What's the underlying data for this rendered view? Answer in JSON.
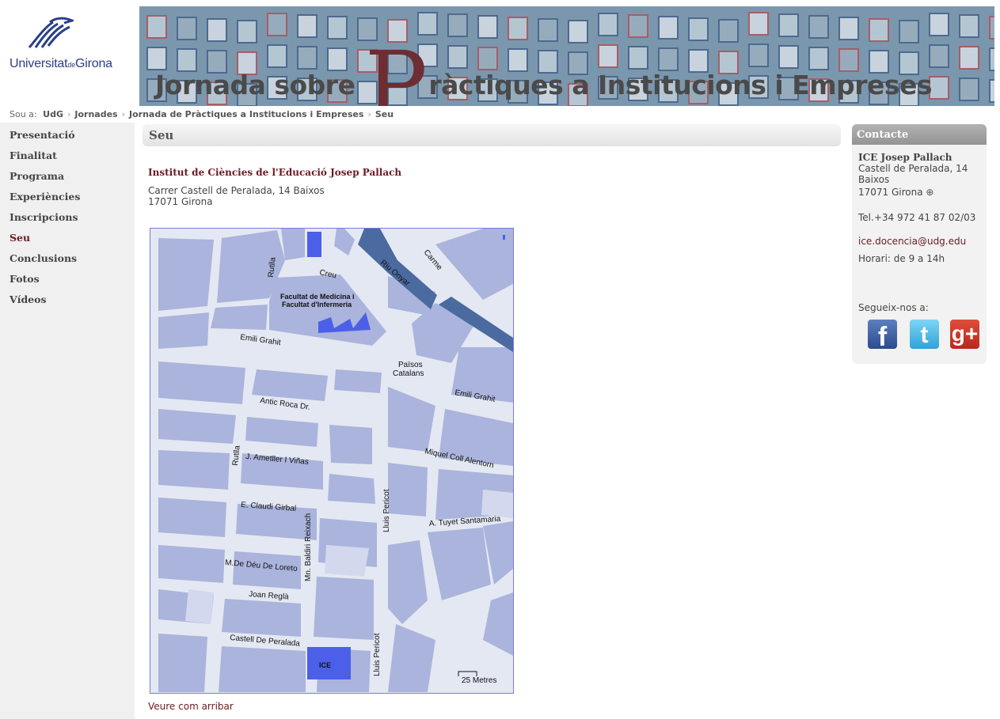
{
  "logo": {
    "name_a": "Universitat",
    "name_de": "de",
    "name_b": "Girona"
  },
  "banner": {
    "title_before": "Jornada sobre",
    "title_P": "P",
    "title_after": "ràctiques a Institucions i Empreses"
  },
  "breadcrumb": {
    "prefix": "Sou a:",
    "items": [
      "UdG",
      "Jornades",
      "Jornada de Pràctiques a Institucions i Empreses",
      "Seu"
    ],
    "sep": "›"
  },
  "nav": [
    {
      "label": "Presentació",
      "active": false
    },
    {
      "label": "Finalitat",
      "active": false
    },
    {
      "label": "Programa",
      "active": false
    },
    {
      "label": "Experiències",
      "active": false
    },
    {
      "label": "Inscripcions",
      "active": false
    },
    {
      "label": "Seu",
      "active": true
    },
    {
      "label": "Conclusions",
      "active": false
    },
    {
      "label": "Fotos",
      "active": false
    },
    {
      "label": "Vídeos",
      "active": false
    }
  ],
  "page": {
    "title": "Seu",
    "institution": "Institut de Ciències de l'Educació Josep Pallach",
    "address_line1": "Carrer Castell de Peralada, 14 Baixos",
    "address_line2": "17071 Girona",
    "directions_link": "Veure com arribar"
  },
  "map": {
    "labels": {
      "rutlla": "Rutlla",
      "creu": "Creu",
      "riu_onyar": "Riu Onyar",
      "carme": "Carme",
      "facultat1": "Facultat de Medicina i",
      "facultat2": "Facultat d'Infermeria",
      "emili_grahit": "Emili Grahit",
      "paisos1": "Països",
      "paisos2": "Catalans",
      "emili_grahit2": "Emili Grahit",
      "antic_roca": "Antic Roca Dr.",
      "rutlla2": "Rutlla",
      "ametller": "J. Ametller I Viñas",
      "miquel": "Miquel Coll Alentorn",
      "lluis_pericot": "Lluis Pericot",
      "claudi": "E. Claudi Girbal",
      "tuyet": "A. Tuyet Santamaria",
      "baldiri": "Mn. Baldiri Reixach",
      "deu": "M.De Déu De Loreto",
      "regla": "Joan Reglà",
      "castell": "Castell De Peralada",
      "lluis_pericot2": "Lluis Pericot",
      "ice": "ICE",
      "scale": "25  Metres"
    }
  },
  "contact": {
    "header": "Contacte",
    "name": "ICE Josep Pallach",
    "address": "Castell de Peralada, 14 Baixos",
    "city": "17071 Girona",
    "city_icon": "crosshair-icon",
    "tel": "Tel.+34 972 41 87 02/03",
    "email": "ice.docencia@udg.edu",
    "hours": "Horari: de 9 a 14h",
    "follow": "Segueix-nos a:",
    "social": [
      {
        "name": "facebook",
        "glyph": "f"
      },
      {
        "name": "twitter",
        "glyph": "t"
      },
      {
        "name": "google-plus",
        "glyph": "g+"
      }
    ]
  }
}
